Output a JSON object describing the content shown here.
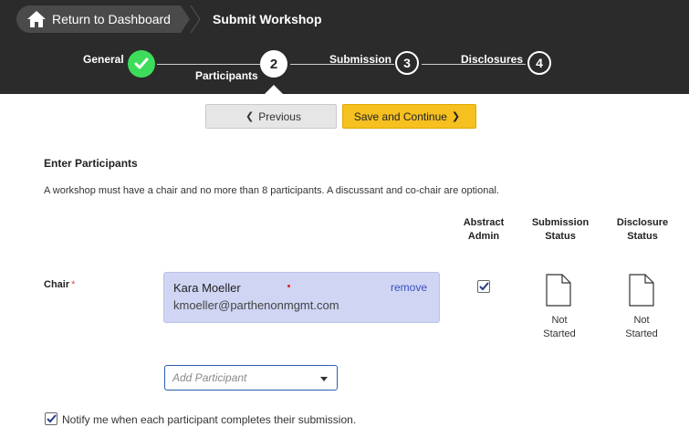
{
  "header": {
    "return_label": "Return to Dashboard",
    "current_page": "Submit Workshop"
  },
  "stepper": {
    "steps": [
      {
        "label": "General",
        "number": "",
        "state": "done"
      },
      {
        "label": "Participants",
        "number": "2",
        "state": "active"
      },
      {
        "label": "Submission",
        "number": "3",
        "state": "pending"
      },
      {
        "label": "Disclosures",
        "number": "4",
        "state": "pending"
      }
    ]
  },
  "nav": {
    "previous_label": "Previous",
    "save_label": "Save and Continue"
  },
  "participants": {
    "title": "Enter Participants",
    "info": "A workshop must have a chair and no more than 8 participants. A discussant and co-chair are optional.",
    "columns": {
      "abstract_admin_1": "Abstract",
      "abstract_admin_2": "Admin",
      "submission_status_1": "Submission",
      "submission_status_2": "Status",
      "disclosure_status_1": "Disclosure",
      "disclosure_status_2": "Status"
    },
    "chair": {
      "role_label": "Chair",
      "required_mark": "*",
      "name": "Kara Moeller",
      "email": "kmoeller@parthenonmgmt.com",
      "remove_label": "remove",
      "abstract_admin": true,
      "submission_status_1": "Not",
      "submission_status_2": "Started",
      "disclosure_status_1": "Not",
      "disclosure_status_2": "Started"
    },
    "add_placeholder": "Add Participant",
    "notify_label": "Notify me when each participant completes their submission.",
    "notify_checked": true
  },
  "colors": {
    "header_bg": "#2b2b2b",
    "done_green": "#3ddc5a",
    "save_yellow": "#f5c020",
    "card_bg": "#cfd5f3",
    "link_blue": "#3a4fc0"
  }
}
